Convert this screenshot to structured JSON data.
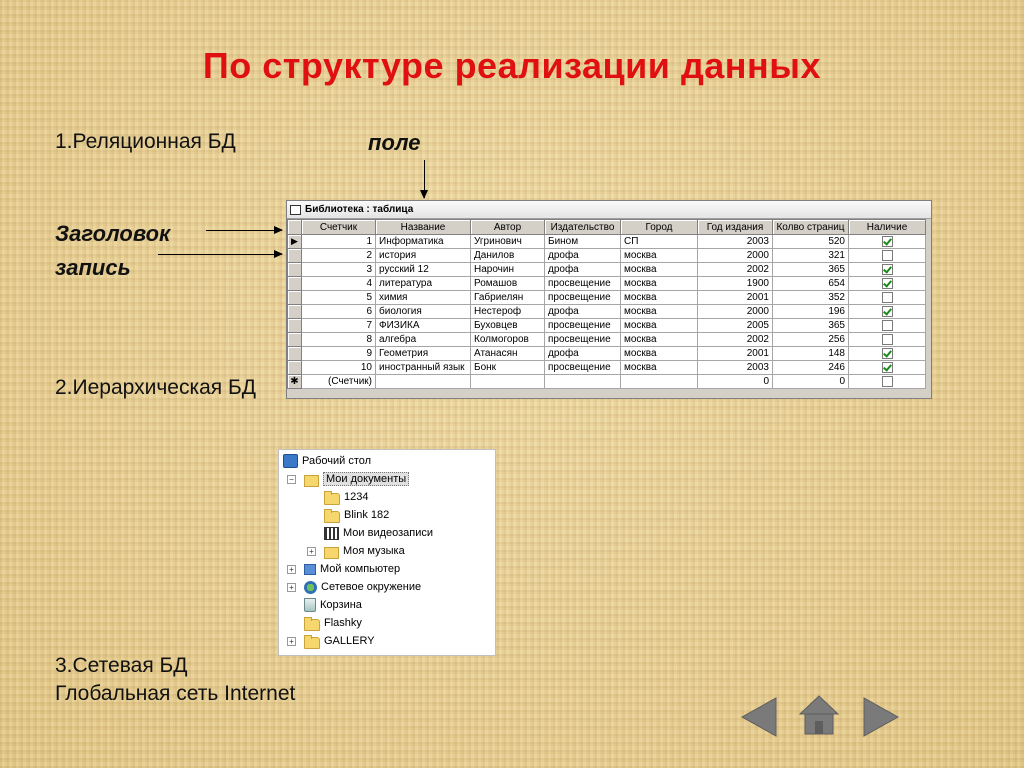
{
  "slide": {
    "title": "По структуре реализации данных",
    "item1": "1.Реляционная БД",
    "field_label": "поле",
    "header_label": "Заголовок",
    "record_label": "запись",
    "item2": "2.Иерархическая БД",
    "item3": "3.Сетевая БД",
    "item3_sub": "Глобальная сеть Internet"
  },
  "db_table": {
    "window_title": "Библиотека : таблица",
    "columns": [
      "Счетчик",
      "Название",
      "Автор",
      "Издательство",
      "Город",
      "Год издания",
      "Колво страниц",
      "Наличие"
    ],
    "rows": [
      {
        "id": "1",
        "name": "Информатика",
        "author": "Угринович",
        "publisher": "Бином",
        "city": "СП",
        "year": "2003",
        "pages": "520",
        "avail": true
      },
      {
        "id": "2",
        "name": "история",
        "author": "Данилов",
        "publisher": "дрофа",
        "city": "москва",
        "year": "2000",
        "pages": "321",
        "avail": false
      },
      {
        "id": "3",
        "name": "русский 12",
        "author": "Нарочин",
        "publisher": "дрофа",
        "city": "москва",
        "year": "2002",
        "pages": "365",
        "avail": true
      },
      {
        "id": "4",
        "name": "литература",
        "author": "Ромашов",
        "publisher": "просвещение",
        "city": "москва",
        "year": "1900",
        "pages": "654",
        "avail": true
      },
      {
        "id": "5",
        "name": "химия",
        "author": "Габриелян",
        "publisher": "просвещение",
        "city": "москва",
        "year": "2001",
        "pages": "352",
        "avail": false
      },
      {
        "id": "6",
        "name": "биология",
        "author": "Нестероф",
        "publisher": "дрофа",
        "city": "москва",
        "year": "2000",
        "pages": "196",
        "avail": true
      },
      {
        "id": "7",
        "name": "ФИЗИКА",
        "author": "Буховцев",
        "publisher": "просвещение",
        "city": "москва",
        "year": "2005",
        "pages": "365",
        "avail": false
      },
      {
        "id": "8",
        "name": "алгебра",
        "author": "Колмогоров",
        "publisher": "просвещение",
        "city": "москва",
        "year": "2002",
        "pages": "256",
        "avail": false
      },
      {
        "id": "9",
        "name": "Геометрия",
        "author": "Атанасян",
        "publisher": "дрофа",
        "city": "москва",
        "year": "2001",
        "pages": "148",
        "avail": true
      },
      {
        "id": "10",
        "name": "иностранный язык",
        "author": "Бонк",
        "publisher": "просвещение",
        "city": "москва",
        "year": "2003",
        "pages": "246",
        "avail": true
      }
    ],
    "new_row": {
      "id": "(Счетчик)",
      "year": "0",
      "pages": "0"
    }
  },
  "tree": {
    "root": "Рабочий стол",
    "my_docs": "Мои документы",
    "f1234": "1234",
    "blink": "Blink 182",
    "videos": "Мои видеозаписи",
    "music": "Моя музыка",
    "computer": "Мой компьютер",
    "network": "Сетевое окружение",
    "recycle": "Корзина",
    "flashky": "Flashky",
    "gallery": "GALLERY"
  },
  "nav": {
    "prev_icon": "arrow-left-icon",
    "home_icon": "home-icon",
    "next_icon": "arrow-right-icon",
    "color": "#7a7a7a"
  }
}
